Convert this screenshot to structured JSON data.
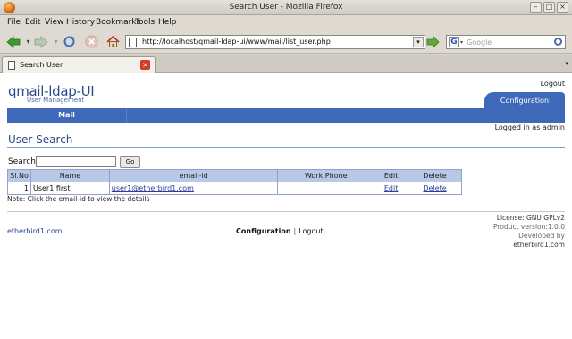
{
  "window": {
    "title": "Search User - Mozilla Firefox"
  },
  "menu": {
    "items": [
      "File",
      "Edit",
      "View",
      "History",
      "Bookmarks",
      "Tools",
      "Help"
    ]
  },
  "nav": {
    "url": "http://localhost/qmail-ldap-ui/www/mail/list_user.php",
    "search_placeholder": "Google"
  },
  "tabs": [
    {
      "label": "Search User"
    }
  ],
  "page": {
    "logo": "qmail-ldap-UI",
    "logo_subtitle": "User Management",
    "top_logout": "Logout",
    "config_tab": "Configuration",
    "menu_mail": "Mail",
    "logged_in": "Logged in as admin",
    "title": "User Search",
    "search_label": "Search",
    "go_label": "Go",
    "table": {
      "headers": [
        "Sl.No",
        "Name",
        "email-id",
        "Work Phone",
        "Edit",
        "Delete"
      ],
      "rows": [
        {
          "slno": "1",
          "name": "User1 first",
          "email": "user1@etherbird1.com",
          "phone": "",
          "edit": "Edit",
          "delete": "Delete"
        }
      ]
    },
    "note": "Note: Click the email-id to view the details",
    "footer": {
      "site": "etherbird1.com",
      "configuration": "Configuration",
      "logout": "Logout",
      "license": "License: GNU GPLv2",
      "version": "Product version:1.0.0",
      "developed_by": "Developed by",
      "developer": "etherbird1.com"
    }
  }
}
